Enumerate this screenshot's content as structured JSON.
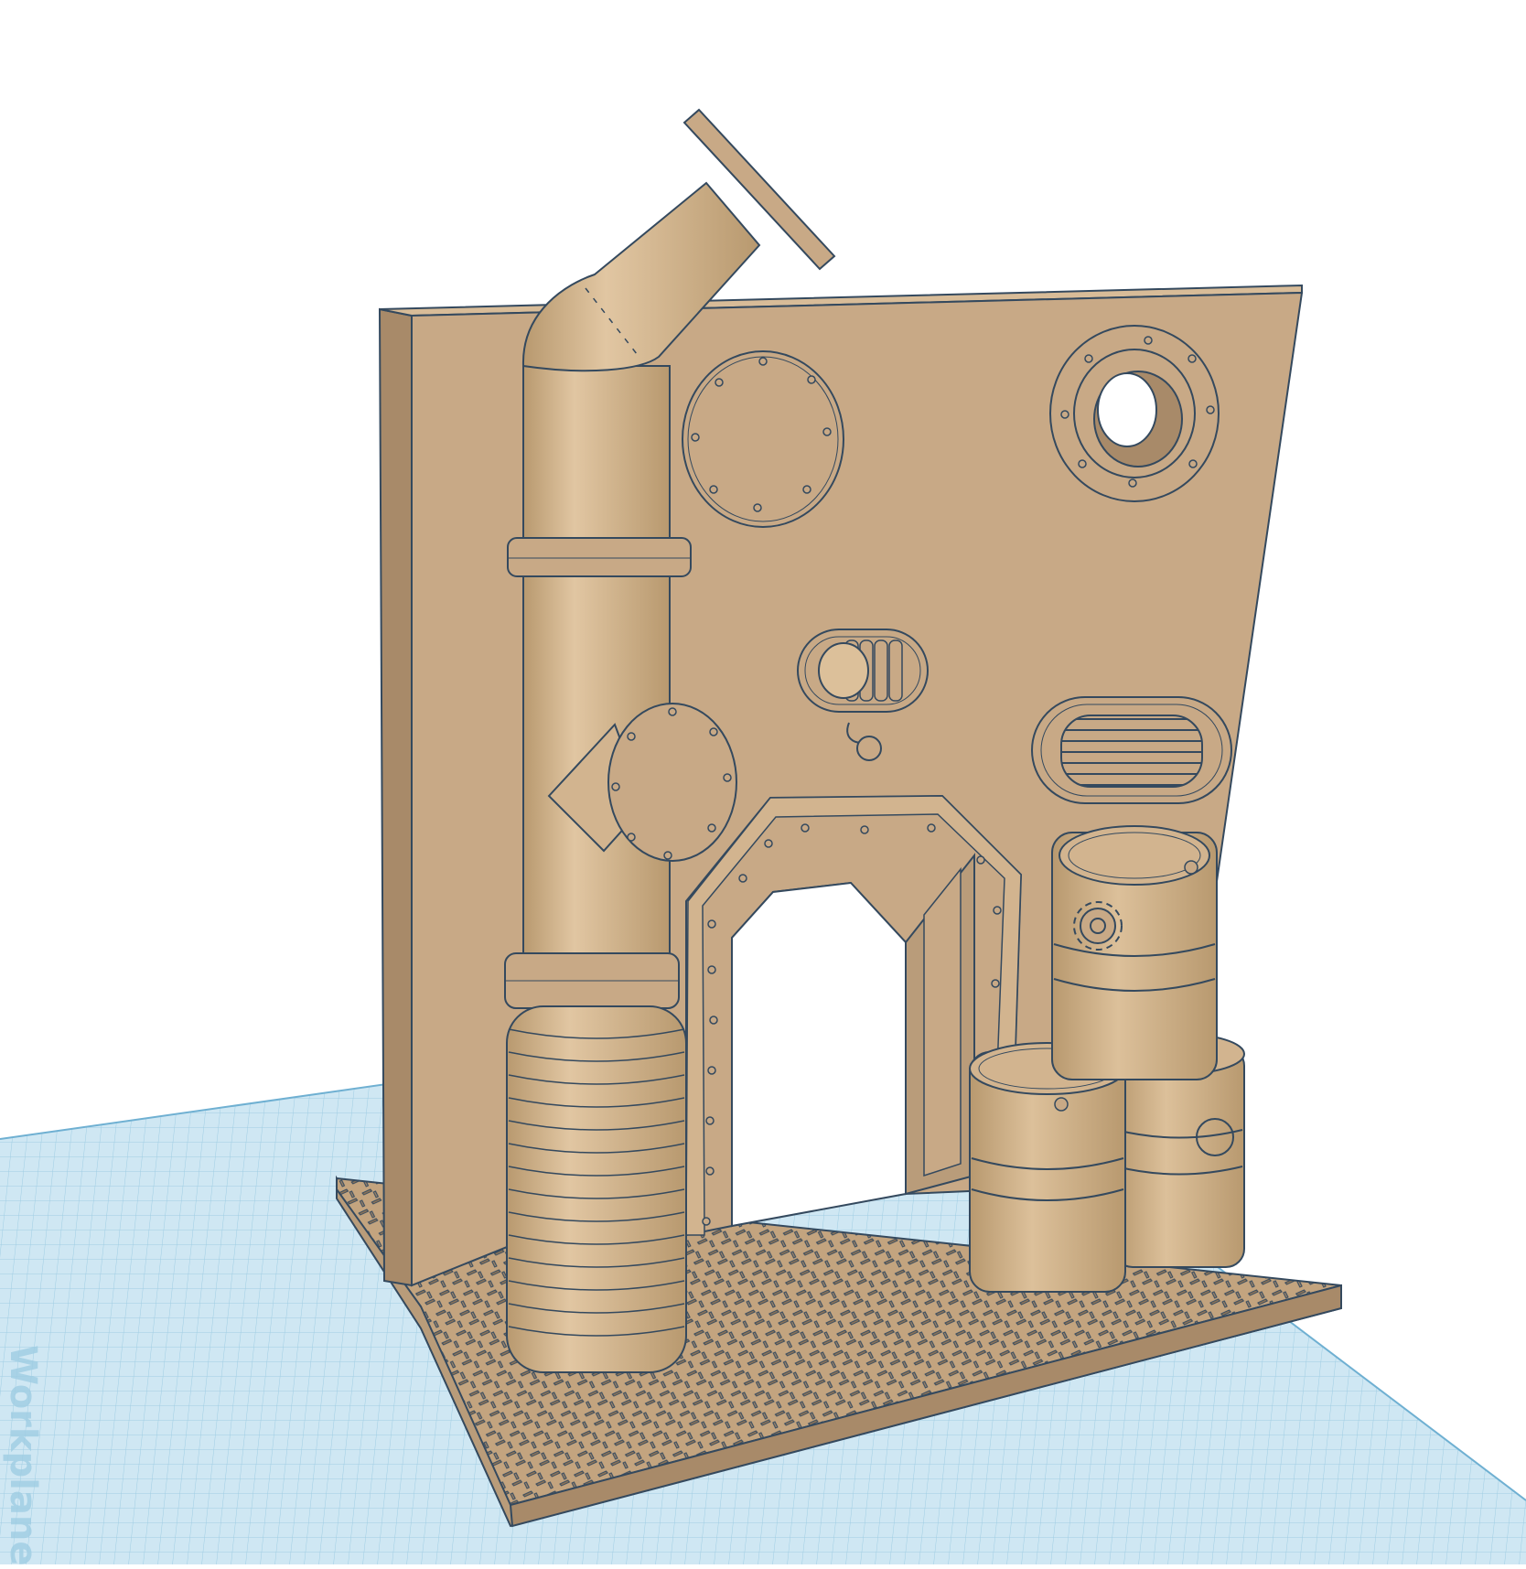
{
  "viewport": {
    "workplane_label": "Workplane",
    "colors": {
      "background": "#ffffff",
      "grid_fill": "#cfe7f3",
      "grid_line": "#8fc4de",
      "grid_major": "#6fb0d2",
      "model_face": "#c8a986",
      "model_front": "#b99c7a",
      "model_side": "#a88a69",
      "model_light": "#d8bc98",
      "outline": "#34495e",
      "hole_dark": "#ffffff"
    },
    "objects": [
      {
        "name": "back-wall",
        "icon": "wall-panel"
      },
      {
        "name": "exhaust-pipe",
        "icon": "elbow-pipe"
      },
      {
        "name": "bellows",
        "icon": "accordion-pipe"
      },
      {
        "name": "doorway",
        "icon": "door-frame"
      },
      {
        "name": "porthole-closed",
        "icon": "porthole"
      },
      {
        "name": "porthole-open",
        "icon": "porthole"
      },
      {
        "name": "vent-grille",
        "icon": "vent"
      },
      {
        "name": "valve-coil",
        "icon": "coil"
      },
      {
        "name": "oil-barrels",
        "icon": "barrel"
      },
      {
        "name": "tread-floor",
        "icon": "diamond-plate"
      }
    ]
  }
}
